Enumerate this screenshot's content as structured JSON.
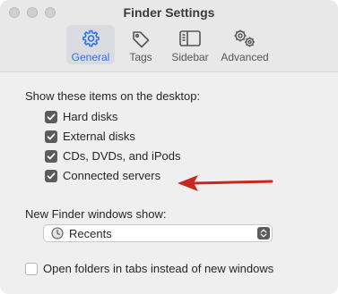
{
  "window": {
    "title": "Finder Settings"
  },
  "tabs": [
    {
      "label": "General",
      "icon": "gear-icon",
      "active": true
    },
    {
      "label": "Tags",
      "icon": "tag-icon",
      "active": false
    },
    {
      "label": "Sidebar",
      "icon": "sidebar-icon",
      "active": false
    },
    {
      "label": "Advanced",
      "icon": "gears-icon",
      "active": false
    }
  ],
  "desktop_section": {
    "heading": "Show these items on the desktop:",
    "items": [
      {
        "label": "Hard disks",
        "checked": true
      },
      {
        "label": "External disks",
        "checked": true
      },
      {
        "label": "CDs, DVDs, and iPods",
        "checked": true
      },
      {
        "label": "Connected servers",
        "checked": true
      }
    ]
  },
  "new_window": {
    "label": "New Finder windows show:",
    "selected": "Recents",
    "icon": "clock-icon"
  },
  "open_folders_tabs": {
    "label": "Open folders in tabs instead of new windows",
    "checked": false
  },
  "colors": {
    "accent": "#2f6fe6",
    "arrow": "#c9271e",
    "checkbox": "#5b5b5b"
  }
}
